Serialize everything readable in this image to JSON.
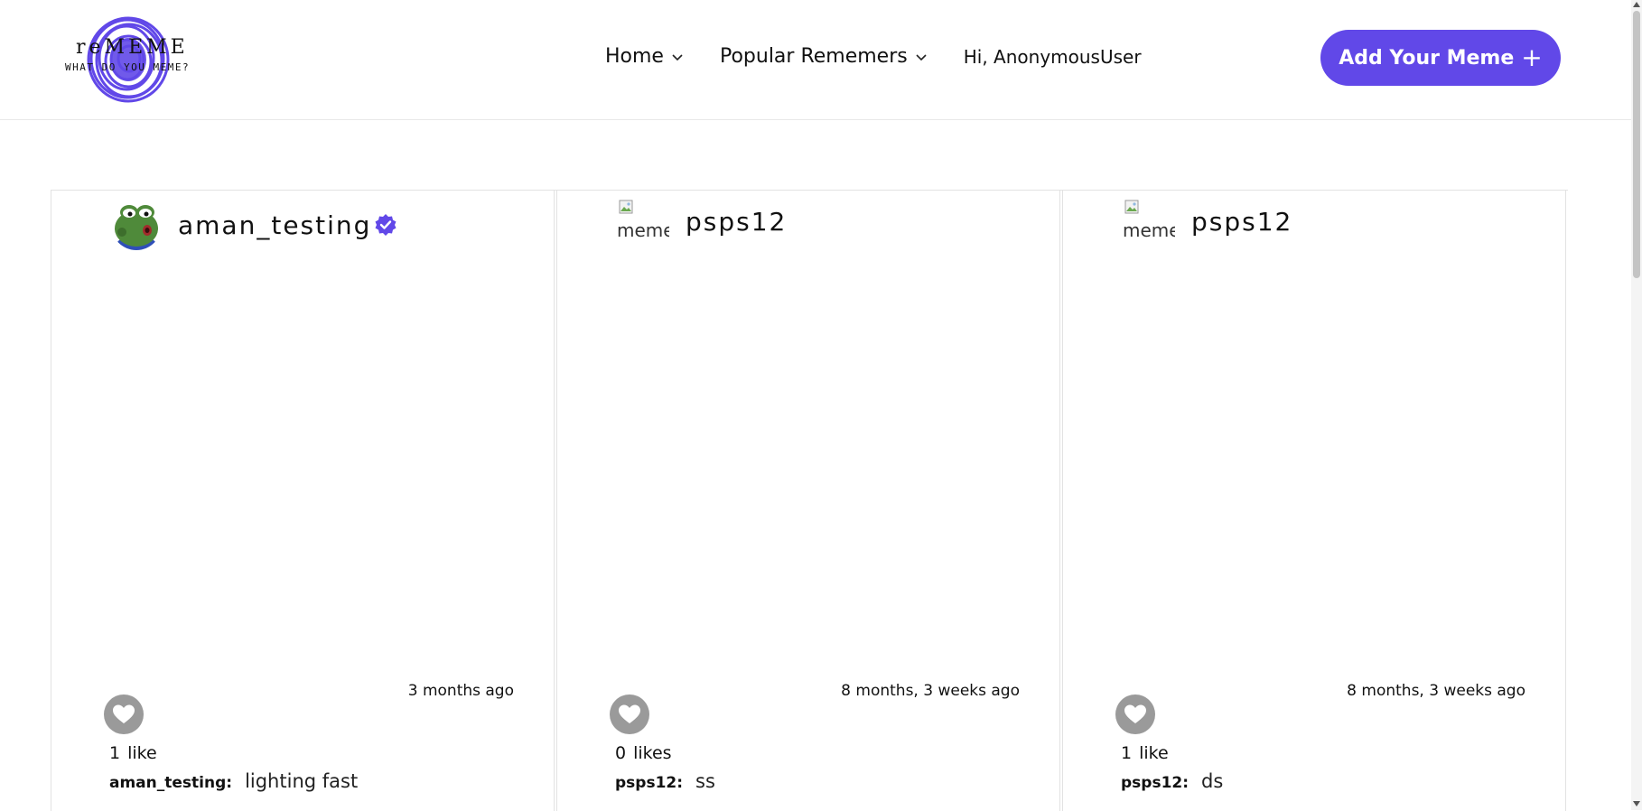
{
  "brand": {
    "name": "reMEME",
    "tagline": "WHAT DO YOU MEME?",
    "accent": "#6148e8"
  },
  "nav": {
    "home_label": "Home",
    "popular_label": "Popular Rememers",
    "greeting": "Hi, AnonymousUser",
    "add_button_label": "Add Your Meme"
  },
  "posts": [
    {
      "username": "aman_testing",
      "verified": true,
      "avatar": "frog-avatar",
      "timestamp": "3 months ago",
      "like_count": "1",
      "like_word": "like",
      "caption_user": "aman_testing:",
      "caption": "lighting fast"
    },
    {
      "username": "psps12",
      "verified": false,
      "avatar_alt": "meme",
      "timestamp": "8 months, 3 weeks ago",
      "like_count": "0",
      "like_word": "likes",
      "caption_user": "psps12:",
      "caption": "ss"
    },
    {
      "username": "psps12",
      "verified": false,
      "avatar_alt": "meme",
      "timestamp": "8 months, 3 weeks ago",
      "like_count": "1",
      "like_word": "like",
      "caption_user": "psps12:",
      "caption": "ds"
    }
  ]
}
